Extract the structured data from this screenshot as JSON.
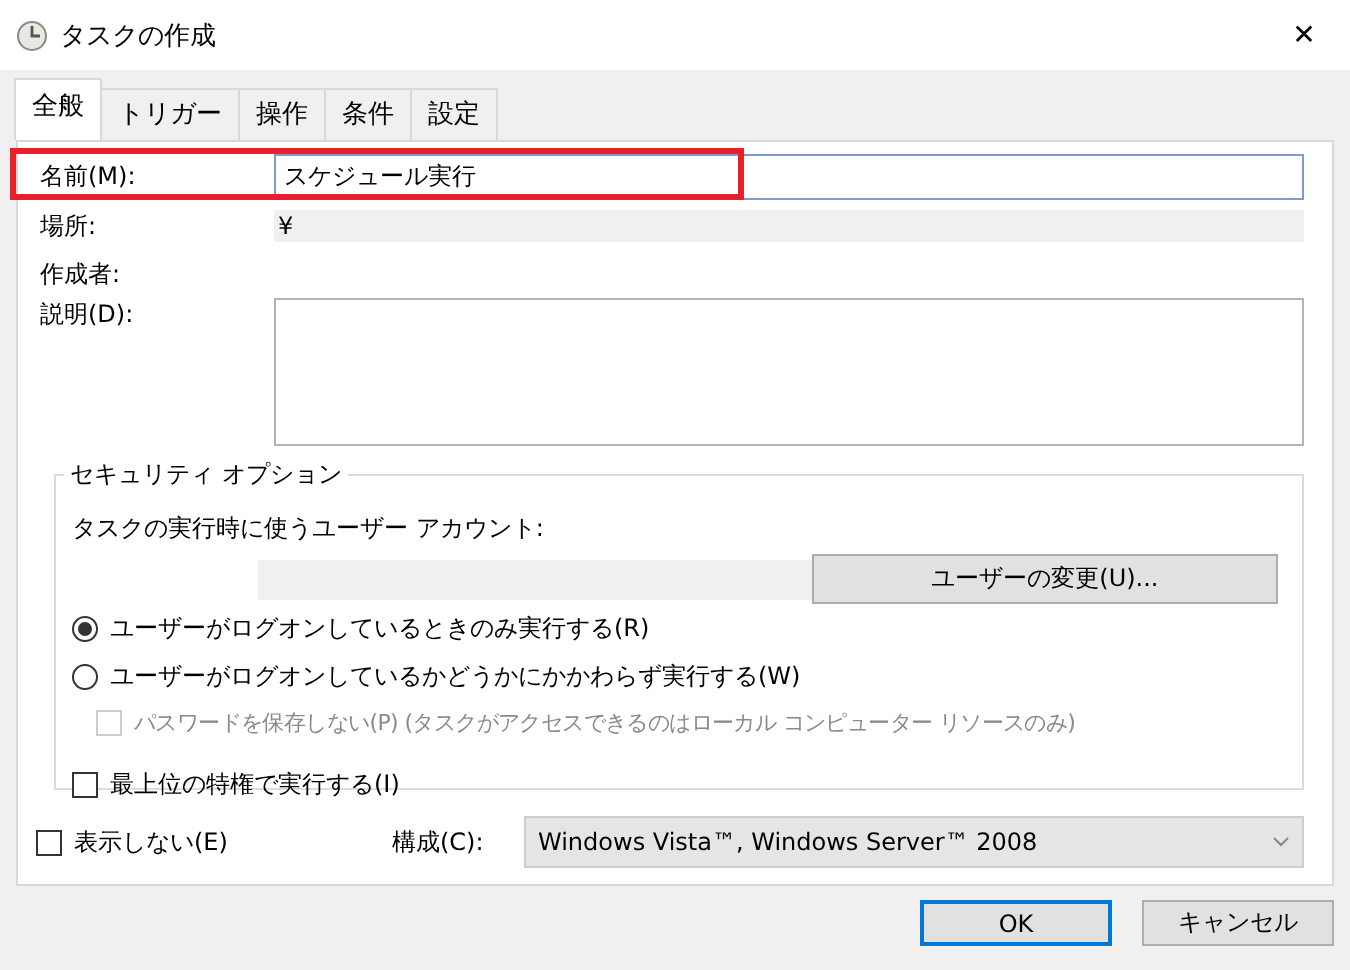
{
  "window": {
    "title": "タスクの作成",
    "close": "✕"
  },
  "tabs": [
    {
      "label": "全般",
      "selected": true
    },
    {
      "label": "トリガー",
      "selected": false
    },
    {
      "label": "操作",
      "selected": false
    },
    {
      "label": "条件",
      "selected": false
    },
    {
      "label": "設定",
      "selected": false
    }
  ],
  "name": {
    "label": "名前(M):",
    "value": "スケジュール実行",
    "highlighted": true
  },
  "location": {
    "label": "場所:",
    "value": "¥"
  },
  "author": {
    "label": "作成者:"
  },
  "description": {
    "label": "説明(D):"
  },
  "security": {
    "legend": "セキュリティ オプション",
    "account_label": "タスクの実行時に使うユーザー アカウント:",
    "change_user_button": "ユーザーの変更(U)...",
    "options": [
      {
        "kind": "radio",
        "label": "ユーザーがログオンしているときのみ実行する(R)",
        "selected": true,
        "disabled": false,
        "indent": false
      },
      {
        "kind": "radio",
        "label": "ユーザーがログオンしているかどうかにかかわらず実行する(W)",
        "selected": false,
        "disabled": false,
        "indent": false
      },
      {
        "kind": "checkbox",
        "label": "パスワードを保存しない(P) (タスクがアクセスできるのはローカル コンピューター リソースのみ)",
        "checked": false,
        "disabled": true,
        "indent": true
      },
      {
        "kind": "spacer"
      },
      {
        "kind": "checkbox",
        "label": "最上位の特権で実行する(I)",
        "checked": false,
        "disabled": false,
        "indent": false
      }
    ]
  },
  "hidden": {
    "label": "表示しない(E)",
    "checked": false
  },
  "configure": {
    "label": "構成(C):",
    "value": "Windows Vista™, Windows Server™ 2008"
  },
  "buttons": [
    {
      "label": "OK",
      "default": true
    },
    {
      "label": "キャンセル",
      "default": false
    }
  ]
}
